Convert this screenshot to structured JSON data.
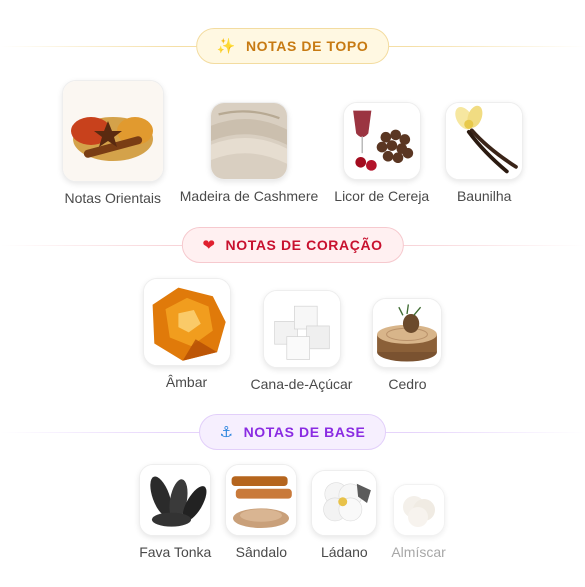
{
  "sections": {
    "top": {
      "title": "NOTAS DE TOPO",
      "icon": "sparkles-icon",
      "color": "#c77a12",
      "items": [
        {
          "label": "Notas Orientais",
          "icon": "spices-image"
        },
        {
          "label": "Madeira de Cashmere",
          "icon": "fabric-image"
        },
        {
          "label": "Licor de Cereja",
          "icon": "cherry-liqueur-image"
        },
        {
          "label": "Baunilha",
          "icon": "vanilla-image"
        }
      ]
    },
    "heart": {
      "title": "NOTAS DE CORAÇÃO",
      "icon": "heart-icon",
      "color": "#c8102e",
      "items": [
        {
          "label": "Âmbar",
          "icon": "amber-image"
        },
        {
          "label": "Cana-de-Açúcar",
          "icon": "sugar-cubes-image"
        },
        {
          "label": "Cedro",
          "icon": "cedar-wood-image"
        }
      ]
    },
    "base": {
      "title": "NOTAS DE BASE",
      "icon": "anchor-icon",
      "color": "#8a2be2",
      "items": [
        {
          "label": "Fava Tonka",
          "icon": "tonka-beans-image"
        },
        {
          "label": "Sândalo",
          "icon": "sandalwood-image"
        },
        {
          "label": "Ládano",
          "icon": "labdanum-flower-image"
        },
        {
          "label": "Almíscar",
          "icon": "musk-image"
        }
      ]
    }
  }
}
